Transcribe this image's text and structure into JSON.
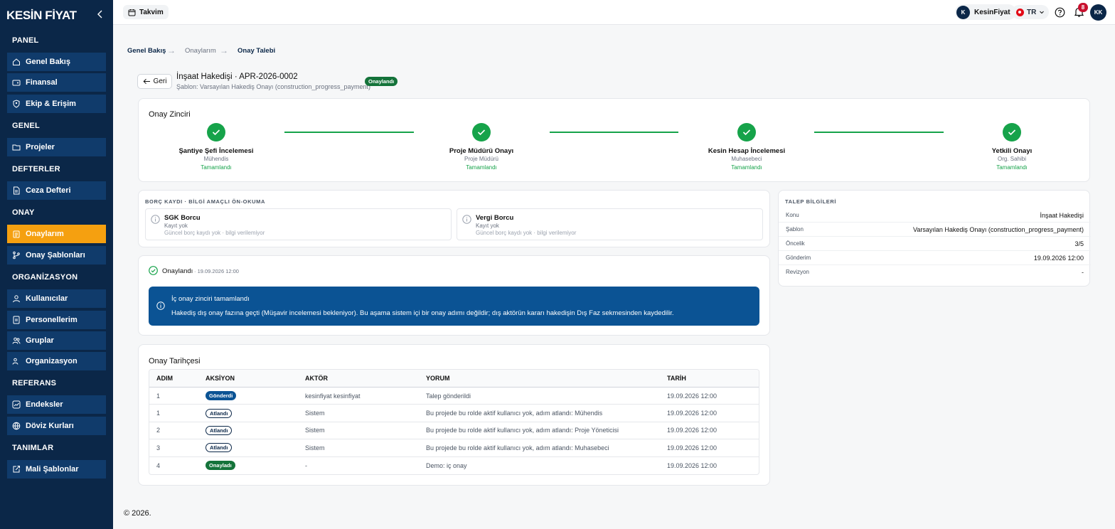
{
  "brand": "KESİN FİYAT",
  "sidebar": {
    "sections": {
      "panel": "PANEL",
      "genel": "GENEL",
      "defterler": "DEFTERLER",
      "onay": "ONAY",
      "organizasyon": "ORGANİZASYON",
      "referans": "REFERANS",
      "tanimlar": "TANIMLAR"
    },
    "items": {
      "genel_bakis": "Genel Bakış",
      "finansal": "Finansal",
      "ekip": "Ekip & Erişim",
      "projeler": "Projeler",
      "ceza": "Ceza Defteri",
      "onaylarim": "Onaylarım",
      "sablonlar": "Onay Şablonları",
      "kullanicilar": "Kullanıcılar",
      "personellerim": "Personellerim",
      "gruplar": "Gruplar",
      "organizasyon": "Organizasyon",
      "endeksler": "Endeksler",
      "doviz": "Döviz Kurları",
      "mali": "Mali Şablonlar"
    },
    "active": "Onaylarım",
    "active_color": "#f5a010"
  },
  "topbar": {
    "calendar": "Takvim",
    "org_initial": "K",
    "org_name": "KesinFiyat",
    "lang": "TR",
    "notif_count": "8",
    "user_initials": "KK"
  },
  "breadcrumb": {
    "b1": "Genel Bakış",
    "b2": "Onaylarım",
    "b3": "Onay Talebi"
  },
  "header": {
    "back": "Geri",
    "title": "İnşaat Hakedişi · APR-2026-0002",
    "template": "Şablon: Varsayılan Hakediş Onayı (construction_progress_payment)",
    "status": "Onaylandı"
  },
  "chain": {
    "title": "Onay Zinciri",
    "steps": [
      {
        "name": "Şantiye Şefi İncelemesi",
        "role": "Mühendis",
        "status": "Tamamlandı"
      },
      {
        "name": "Proje Müdürü Onayı",
        "role": "Proje Müdürü",
        "status": "Tamamlandı"
      },
      {
        "name": "Kesin Hesap İncelemesi",
        "role": "Muhasebeci",
        "status": "Tamamlandı"
      },
      {
        "name": "Yetkili Onayı",
        "role": "Org. Sahibi",
        "status": "Tamamlandı"
      }
    ]
  },
  "debt": {
    "title": "BORÇ KAYDI · BİLGİ AMAÇLI ÖN-OKUMA",
    "items": [
      {
        "name": "SGK Borcu",
        "status": "Kayıt yok",
        "note": "Güncel borç kaydı yok · bilgi verilemiyor"
      },
      {
        "name": "Vergi Borcu",
        "status": "Kayıt yok",
        "note": "Güncel borç kaydı yok · bilgi verilemiyor"
      }
    ]
  },
  "result": {
    "label": "Onaylandı",
    "time": "· 19.09.2026 12:00",
    "info_title": "İç onay zinciri tamamlandı",
    "info_text": "Hakediş dış onay fazına geçti (Müşavir incelemesi bekleniyor). Bu aşama sistem içi bir onay adımı değildir; dış aktörün kararı hakedişin Dış Faz sekmesinden kaydedilir."
  },
  "history": {
    "title": "Onay Tarihçesi",
    "headers": [
      "ADIM",
      "AKSİYON",
      "AKTÖR",
      "YORUM",
      "TARİH"
    ],
    "rows": [
      {
        "step": "1",
        "action": "Gönderdi",
        "actor": "kesinfiyat kesinfiyat",
        "comment": "Talep gönderildi",
        "date": "19.09.2026 12:00"
      },
      {
        "step": "1",
        "action": "Atlandı",
        "actor": "Sistem",
        "comment": "Bu projede bu rolde aktif kullanıcı yok, adım atlandı: Mühendis",
        "date": "19.09.2026 12:00"
      },
      {
        "step": "2",
        "action": "Atlandı",
        "actor": "Sistem",
        "comment": "Bu projede bu rolde aktif kullanıcı yok, adım atlandı: Proje Yöneticisi",
        "date": "19.09.2026 12:00"
      },
      {
        "step": "3",
        "action": "Atlandı",
        "actor": "Sistem",
        "comment": "Bu projede bu rolde aktif kullanıcı yok, adım atlandı: Muhasebeci",
        "date": "19.09.2026 12:00"
      },
      {
        "step": "4",
        "action": "Onayladı",
        "actor": "-",
        "comment": "Demo: iç onay",
        "date": "19.09.2026 12:00"
      }
    ]
  },
  "request": {
    "title": "TALEP BİLGİLERİ",
    "fields": [
      {
        "k": "Konu",
        "v": "İnşaat Hakedişi"
      },
      {
        "k": "Şablon",
        "v": "Varsayılan Hakediş Onayı (construction_progress_payment)"
      },
      {
        "k": "Öncelik",
        "v": "3/5"
      },
      {
        "k": "Gönderim",
        "v": "19.09.2026 12:00"
      },
      {
        "k": "Revizyon",
        "v": "-"
      }
    ]
  },
  "footer": "© 2026."
}
